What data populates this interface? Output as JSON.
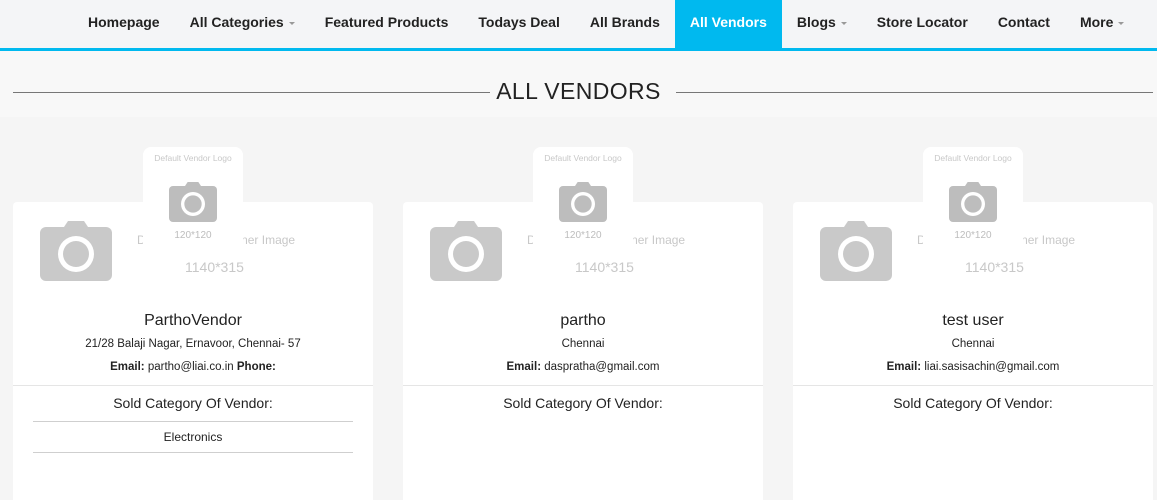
{
  "nav": {
    "items": [
      {
        "label": "Homepage",
        "caret": false,
        "active": false
      },
      {
        "label": "All Categories",
        "caret": true,
        "active": false
      },
      {
        "label": "Featured Products",
        "caret": false,
        "active": false
      },
      {
        "label": "Todays Deal",
        "caret": false,
        "active": false
      },
      {
        "label": "All Brands",
        "caret": false,
        "active": false
      },
      {
        "label": "All Vendors",
        "caret": false,
        "active": true
      },
      {
        "label": "Blogs",
        "caret": true,
        "active": false
      },
      {
        "label": "Store Locator",
        "caret": false,
        "active": false
      },
      {
        "label": "Contact",
        "caret": false,
        "active": false
      },
      {
        "label": "More",
        "caret": true,
        "active": false
      }
    ],
    "accent_color": "#00b9ef"
  },
  "page": {
    "title": "ALL VENDORS"
  },
  "placeholders": {
    "logo_text": "Default Vendor Logo",
    "logo_size": "120*120",
    "banner_text": "Default Vendor Banner Image",
    "banner_size": "1140*315",
    "icon": "camera-icon"
  },
  "vendors": [
    {
      "name": "ParthoVendor",
      "address": "21/28 Balaji Nagar, Ernavoor, Chennai- 57",
      "email_label": "Email:",
      "email": "partho@liai.co.in",
      "phone_label": "Phone:",
      "sold_title": "Sold Category Of Vendor:",
      "categories": [
        "Electronics"
      ]
    },
    {
      "name": "partho",
      "address": "Chennai",
      "email_label": "Email:",
      "email": "daspratha@gmail.com",
      "sold_title": "Sold Category Of Vendor:",
      "categories": []
    },
    {
      "name": "test user",
      "address": "Chennai",
      "email_label": "Email:",
      "email": "liai.sasisachin@gmail.com",
      "sold_title": "Sold Category Of Vendor:",
      "categories": []
    }
  ]
}
